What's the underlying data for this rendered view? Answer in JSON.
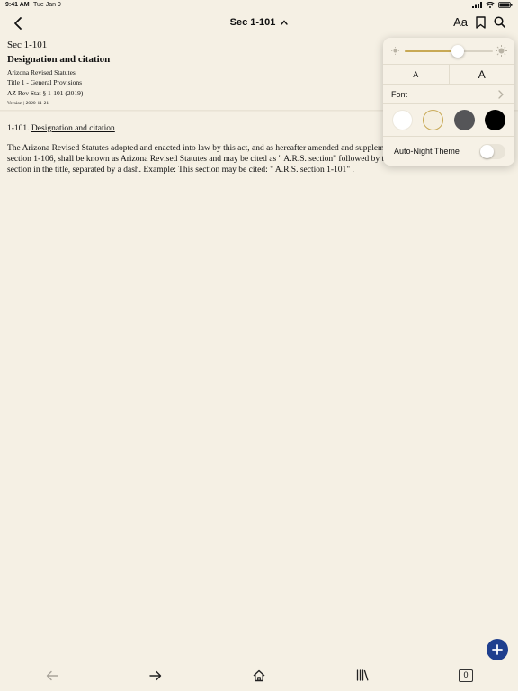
{
  "status_bar": {
    "time": "9:41 AM",
    "date": "Tue Jan 9"
  },
  "nav": {
    "title": "Sec 1-101",
    "text_settings_label": "Aa",
    "icons": [
      "chevron-left-icon",
      "chevron-up-icon",
      "bookmark-icon",
      "search-icon"
    ]
  },
  "document": {
    "section": "Sec 1-101",
    "heading": "Designation and citation",
    "source": "Arizona Revised Statutes",
    "title_line": "Title 1 - General Provisions",
    "citation": "AZ Rev Stat § 1-101 (2019)",
    "version": "Version | 2020-11-21",
    "section_number": "1-101.",
    "section_link": "Designation and citation",
    "body": "The Arizona Revised Statutes adopted and enacted into law by this act, and as hereafter amended and supplemented, and published pursuant to section 1-106, shall be known as Arizona Revised Statutes and may be cited as \" A.R.S. section\" followed by the title and the number of the section in the title, separated by a dash. Example: This section may be cited: \" A.R.S. section 1-101\" ."
  },
  "display_settings": {
    "brightness": 0.6,
    "font_size_small_label": "A",
    "font_size_large_label": "A",
    "font_label": "Font",
    "themes": [
      {
        "name": "white",
        "color": "#ffffff",
        "selected": false
      },
      {
        "name": "sepia",
        "color": "#f5efe0",
        "selected": true
      },
      {
        "name": "gray",
        "color": "#555558",
        "selected": false
      },
      {
        "name": "black",
        "color": "#000000",
        "selected": false
      }
    ],
    "auto_night_label": "Auto-Night Theme",
    "auto_night_enabled": false,
    "accent_color": "#c8a955"
  },
  "fab": {
    "icon": "plus-icon",
    "color": "#1f3f8e"
  },
  "tab_bar": {
    "icons": [
      "arrow-left-icon",
      "arrow-right-icon",
      "home-icon",
      "library-icon",
      "tabs-count-icon"
    ],
    "open_tabs_count": "0"
  }
}
